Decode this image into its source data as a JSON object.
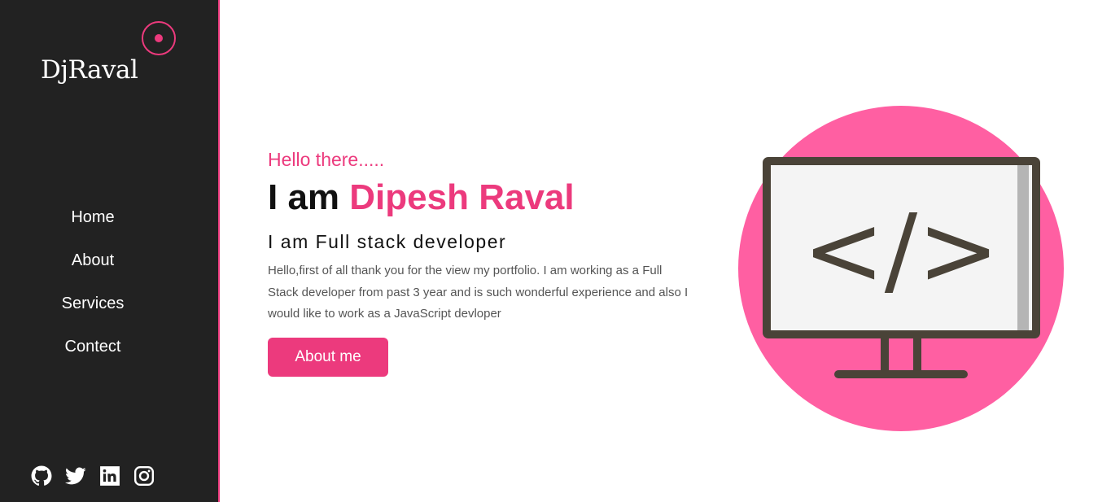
{
  "brand": {
    "logo_text": "DjRaval",
    "accent": "#ec3a7d"
  },
  "nav": {
    "items": [
      {
        "label": "Home"
      },
      {
        "label": "About"
      },
      {
        "label": "Services"
      },
      {
        "label": "Contect"
      }
    ]
  },
  "social": {
    "icons": [
      "github-icon",
      "twitter-icon",
      "linkedin-icon",
      "instagram-icon"
    ]
  },
  "hero": {
    "greeting": "Hello there.....",
    "headline_prefix": "I am ",
    "name": "Dipesh Raval",
    "role": "I am Full stack developer",
    "description": "Hello,first of all thank you for the view my portfolio. I am working as a Full Stack developer from past 3 year and is such wonderful experience and also I would like to work as a JavaScript devloper",
    "button_label": "About me"
  },
  "illustration": {
    "code_symbol": "</>",
    "circle_color": "#ff5fa2",
    "monitor_color": "#4a4338",
    "screen_color": "#f4f4f4",
    "icon": "monitor-code-icon"
  },
  "colors": {
    "sidebar_bg": "#222222",
    "text_dark": "#111111",
    "text_muted": "#555555"
  }
}
